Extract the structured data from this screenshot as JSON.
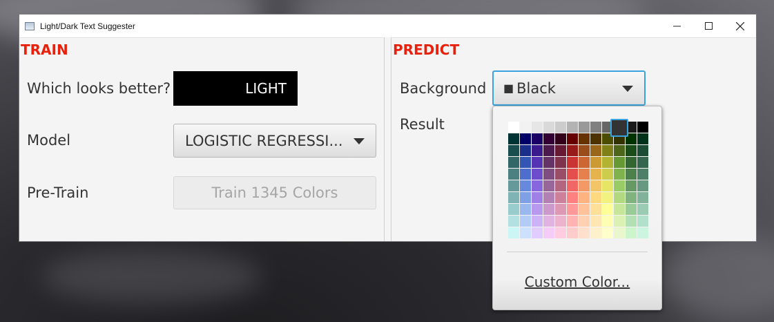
{
  "window": {
    "title": "Light/Dark Text Suggester"
  },
  "train": {
    "title": "TRAIN",
    "question_label": "Which looks better?",
    "preview_text": "LIGHT",
    "model_label": "Model",
    "model_value": "LOGISTIC REGRESSI...",
    "pretrain_label": "Pre-Train",
    "pretrain_button": "Train 1345 Colors"
  },
  "predict": {
    "title": "PREDICT",
    "background_label": "Background",
    "background_value": "Black",
    "background_glyph": "■",
    "result_label": "Result"
  },
  "color_picker": {
    "selected_color": "#333333",
    "custom_color_label": "Custom Color...",
    "palette": [
      [
        "#ffffff",
        "#f2f2f2",
        "#e6e6e6",
        "#d9d9d9",
        "#cccccc",
        "#b3b3b3",
        "#999999",
        "#808080",
        "#666666",
        "#333333",
        "#1a1a1a",
        "#000000"
      ],
      [
        "#003333",
        "#000066",
        "#1a0066",
        "#330033",
        "#330019",
        "#660000",
        "#663300",
        "#4d3300",
        "#4d4d00",
        "#333300",
        "#003300",
        "#003319"
      ],
      [
        "#1a4d4d",
        "#1a2f8c",
        "#3a1a8c",
        "#4d1a4d",
        "#661a33",
        "#991a1a",
        "#994d1a",
        "#99661a",
        "#808019",
        "#4d661a",
        "#1a4d1a",
        "#1a4d33"
      ],
      [
        "#336666",
        "#3355b3",
        "#5533b3",
        "#663366",
        "#80334d",
        "#cc3333",
        "#cc6633",
        "#cc9933",
        "#b3b333",
        "#669933",
        "#336633",
        "#33664d"
      ],
      [
        "#4d8080",
        "#4d6ecc",
        "#6e4dcc",
        "#804d80",
        "#994d66",
        "#e64d4d",
        "#e6804d",
        "#e6b34d",
        "#cccc4d",
        "#80b34d",
        "#4d804d",
        "#4d8066"
      ],
      [
        "#669999",
        "#6688dd",
        "#8866dd",
        "#996699",
        "#b36680",
        "#f26666",
        "#f29966",
        "#f2c666",
        "#e6e666",
        "#99cc66",
        "#669966",
        "#669980"
      ],
      [
        "#80b3b3",
        "#80a0e6",
        "#a080e6",
        "#b380b3",
        "#cc8099",
        "#ff8080",
        "#ffb380",
        "#ffd980",
        "#f2f280",
        "#b3d980",
        "#80b380",
        "#80b399"
      ],
      [
        "#99cccc",
        "#99b8ee",
        "#b899ee",
        "#cc99cc",
        "#dd99b3",
        "#ff9999",
        "#ffc299",
        "#ffe099",
        "#ffff99",
        "#c6e699",
        "#99cc99",
        "#99ccb3"
      ],
      [
        "#b3e0e0",
        "#b3ccf5",
        "#ccb3f5",
        "#e0b3e0",
        "#eeb3cc",
        "#ffb3b3",
        "#ffd1b3",
        "#ffe6b3",
        "#ffffb3",
        "#d9f2b3",
        "#b3e0b3",
        "#b3e0cc"
      ],
      [
        "#ccf5f5",
        "#cce0ff",
        "#e0ccff",
        "#f5ccf5",
        "#ffcce0",
        "#ffcccc",
        "#ffe0cc",
        "#fff0cc",
        "#ffffcc",
        "#eaf7cc",
        "#ccf5cc",
        "#ccf5e0"
      ]
    ]
  }
}
